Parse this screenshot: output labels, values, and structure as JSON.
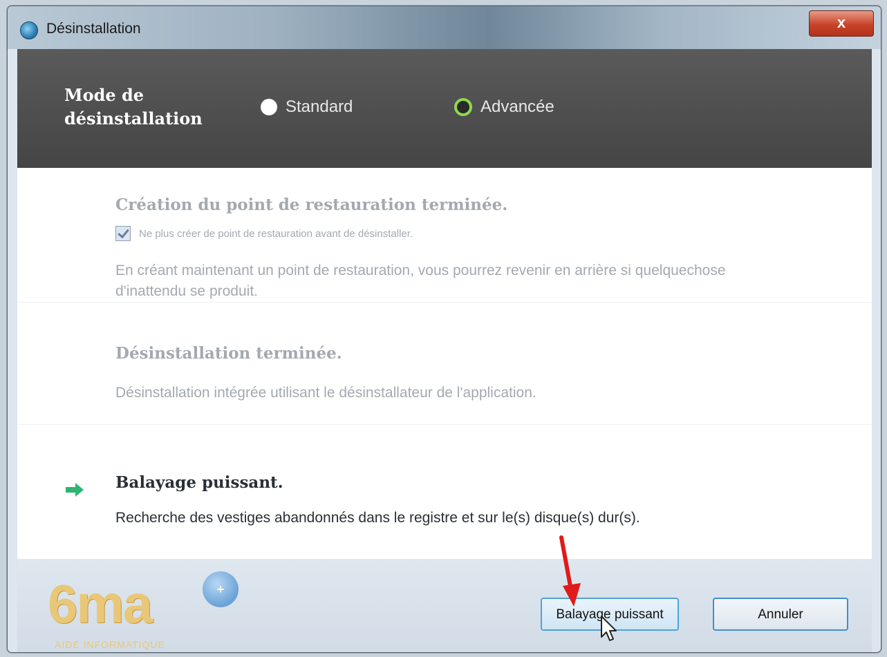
{
  "window": {
    "title": "Désinstallation",
    "close_label": "x"
  },
  "mode": {
    "label_line1": "Mode de",
    "label_line2": "désinstallation",
    "option_standard": "Standard",
    "option_advanced": "Advancée",
    "selected": "Advancée"
  },
  "steps": [
    {
      "title": "Création du point de restauration terminée.",
      "checkbox_label": "Ne plus créer de point de restauration avant de désinstaller.",
      "checkbox_checked": true,
      "description": "En créant maintenant un point de restauration, vous pourrez revenir en arrière si quelquechose d'inattendu se produit."
    },
    {
      "title": "Désinstallation terminée.",
      "description": "Désinstallation intégrée utilisant le désinstallateur de l'application."
    },
    {
      "title": "Balayage puissant.",
      "description": "Recherche des vestiges abandonnés dans le registre et sur le(s) disque(s) dur(s).",
      "active": true
    }
  ],
  "buttons": {
    "scan": "Balayage puissant",
    "cancel": "Annuler"
  },
  "watermark": {
    "logo": "6ma",
    "badge": "+",
    "tagline": "AIDE INFORMATIQUE"
  },
  "colors": {
    "accent_green": "#8fd84f",
    "arrow_green": "#2bb673",
    "annotation_red": "#e01b1b"
  }
}
